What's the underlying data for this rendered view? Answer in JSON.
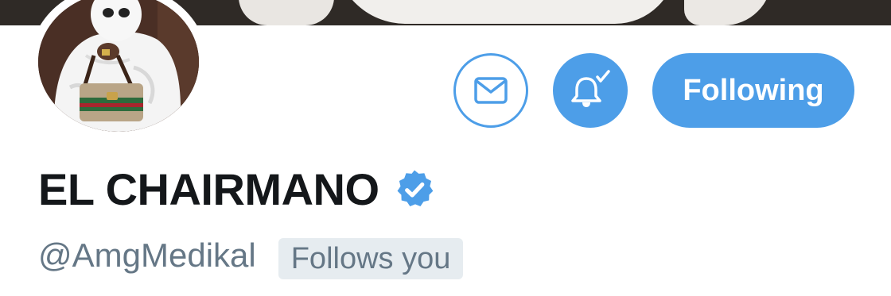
{
  "banner": {
    "icon": "banner-photo"
  },
  "profile": {
    "avatar_icon": "profile-photo",
    "display_name": "EL CHAIRMANO",
    "verified": true,
    "verified_icon": "verified-badge-icon",
    "handle": "@AmgMedikal",
    "follows_you_label": "Follows you"
  },
  "actions": {
    "message_icon": "envelope-icon",
    "notifications_icon": "bell-check-icon",
    "following_label": "Following"
  },
  "colors": {
    "accent": "#4d9ee8",
    "name_text": "#14171a",
    "secondary_text": "#657786",
    "badge_bg": "#e6ecf0"
  }
}
